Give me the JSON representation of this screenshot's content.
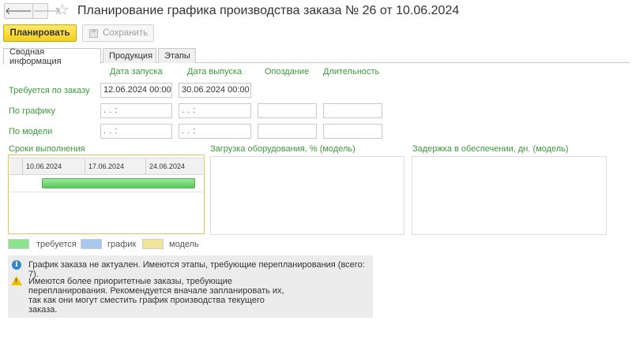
{
  "header": {
    "back_glyph": "🡐",
    "forward_glyph": "🡒",
    "star_glyph": "☆",
    "title": "Планирование графика производства заказа № 26 от 10.06.2024"
  },
  "toolbar": {
    "plan_label": "Планировать",
    "save_label": "Сохранить"
  },
  "tabs": [
    {
      "label": "Сводная информация",
      "active": true
    },
    {
      "label": "Продукция",
      "active": false
    },
    {
      "label": "Этапы",
      "active": false
    }
  ],
  "grid": {
    "columns": [
      "Дата запуска",
      "Дата выпуска",
      "Опоздание",
      "Длительность"
    ],
    "rows": [
      {
        "label": "Требуется по заказу",
        "start": "12.06.2024 00:00",
        "end": "30.06.2024 00:00",
        "delay": "",
        "duration": ""
      },
      {
        "label": "По графику",
        "start": " .  .       :",
        "end": " .  .       :",
        "delay": "",
        "duration": ""
      },
      {
        "label": "По модели",
        "start": " .  .       :",
        "end": " .  .       :",
        "delay": "",
        "duration": ""
      }
    ]
  },
  "sections": {
    "deadlines": "Сроки выполнения",
    "equipment_load": "Загрузка оборудования, % (модель)",
    "supply_delay": "Задержка в обеспечении, дн. (модель)"
  },
  "gantt": {
    "ticks": [
      "10.06.2024",
      "17.06.2024",
      "24.06.2024"
    ]
  },
  "legend": [
    {
      "label": "требуется",
      "color": "#8fe38f"
    },
    {
      "label": "график",
      "color": "#a9c8ee"
    },
    {
      "label": "модель",
      "color": "#efe59a"
    }
  ],
  "messages": {
    "info": "График заказа не актуален. Имеются этапы, требующие перепланирования (всего: 7).",
    "warning_lines": [
      "Имеются более приоритетные заказы, требующие",
      "перепланирования. Рекомендуется вначале запланировать их,",
      "так как они могут сместить график производства текущего",
      "заказа."
    ]
  }
}
